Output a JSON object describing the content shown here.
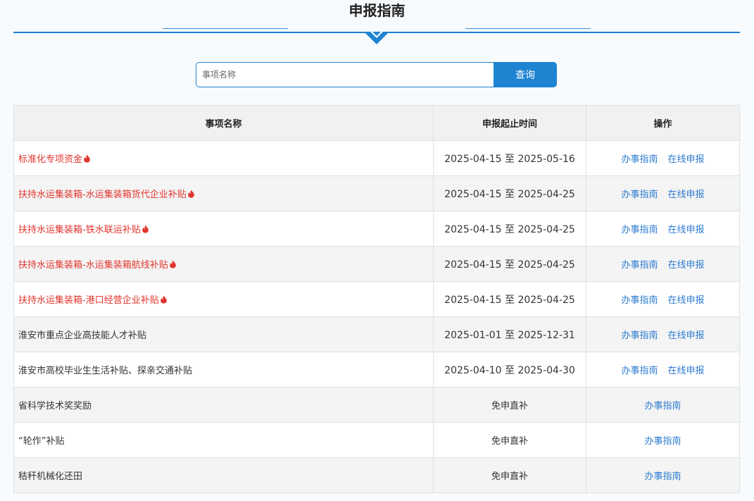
{
  "page": {
    "title": "申报指南"
  },
  "search": {
    "placeholder": "事项名称",
    "button_label": "查询"
  },
  "colors": {
    "accent": "#1e84d2",
    "hot_text": "#e0352e",
    "link": "#2d7bd0"
  },
  "table": {
    "headers": [
      "事项名称",
      "申报起止时间",
      "操作"
    ],
    "rows": [
      {
        "name": "标准化专项资金",
        "period": "2025-04-15 至 2025-05-16",
        "hot": true,
        "actions": [
          "办事指南",
          "在线申报"
        ]
      },
      {
        "name": "扶持水运集装箱-水运集装箱货代企业补贴",
        "period": "2025-04-15 至 2025-04-25",
        "hot": true,
        "actions": [
          "办事指南",
          "在线申报"
        ]
      },
      {
        "name": "扶持水运集装箱-铁水联运补贴",
        "period": "2025-04-15 至 2025-04-25",
        "hot": true,
        "actions": [
          "办事指南",
          "在线申报"
        ]
      },
      {
        "name": "扶持水运集装箱-水运集装箱航线补贴",
        "period": "2025-04-15 至 2025-04-25",
        "hot": true,
        "actions": [
          "办事指南",
          "在线申报"
        ]
      },
      {
        "name": "扶持水运集装箱-港口经营企业补贴",
        "period": "2025-04-15 至 2025-04-25",
        "hot": true,
        "actions": [
          "办事指南",
          "在线申报"
        ]
      },
      {
        "name": "淮安市重点企业高技能人才补贴",
        "period": "2025-01-01 至 2025-12-31",
        "hot": false,
        "actions": [
          "办事指南",
          "在线申报"
        ]
      },
      {
        "name": "淮安市高校毕业生生活补贴、探亲交通补贴",
        "period": "2025-04-10 至 2025-04-30",
        "hot": false,
        "actions": [
          "办事指南",
          "在线申报"
        ]
      },
      {
        "name": "省科学技术奖奖励",
        "period": "免申直补",
        "hot": false,
        "actions": [
          "办事指南"
        ]
      },
      {
        "name": "“轮作”补贴",
        "period": "免申直补",
        "hot": false,
        "actions": [
          "办事指南"
        ]
      },
      {
        "name": "秸秆机械化还田",
        "period": "免申直补",
        "hot": false,
        "actions": [
          "办事指南"
        ]
      }
    ]
  }
}
